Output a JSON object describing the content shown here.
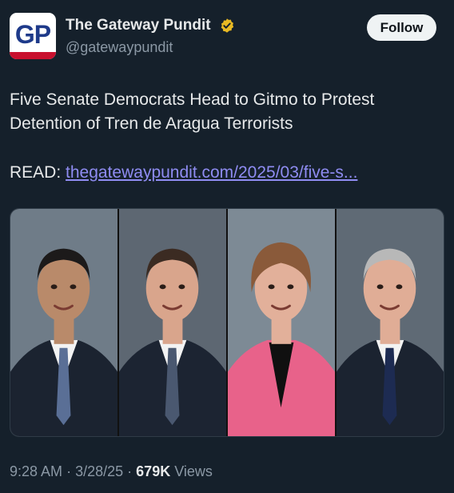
{
  "account": {
    "display_name": "The Gateway Pundit",
    "handle": "@gatewaypundit",
    "avatar_text": "GP",
    "verified_color": "#e8b923"
  },
  "follow_button": {
    "label": "Follow"
  },
  "tweet": {
    "text": "Five Senate Democrats Head to Gitmo to Protest Detention of Tren de Aragua Terrorists",
    "read_prefix": "READ:",
    "link_text": "thegatewaypundit.com/2025/03/five-s..."
  },
  "media": {
    "portraits": [
      {
        "background": "#6f7c88",
        "suit": "#1b2330",
        "tie": "#5a6f96",
        "skin": "#b98a6a",
        "hair": "#1c1a1a",
        "top": "#f3f3f3"
      },
      {
        "background": "#5d6772",
        "suit": "#1c2432",
        "tie": "#4a5870",
        "skin": "#d9a58c",
        "hair": "#3b2b22",
        "top": "#f3f3f3"
      },
      {
        "background": "#7d8a95",
        "suit": "#e8628a",
        "tie": "#101010",
        "skin": "#e2b09a",
        "hair": "#8a5a3a",
        "top": "#101010"
      },
      {
        "background": "#5f6a75",
        "suit": "#1b2330",
        "tie": "#1d2b52",
        "skin": "#e0ad96",
        "hair": "#b8b8b8",
        "top": "#f3f3f3"
      }
    ]
  },
  "footer": {
    "time": "9:28 AM",
    "date": "3/28/25",
    "views_count": "679K",
    "views_label": "Views",
    "separator": "·"
  }
}
